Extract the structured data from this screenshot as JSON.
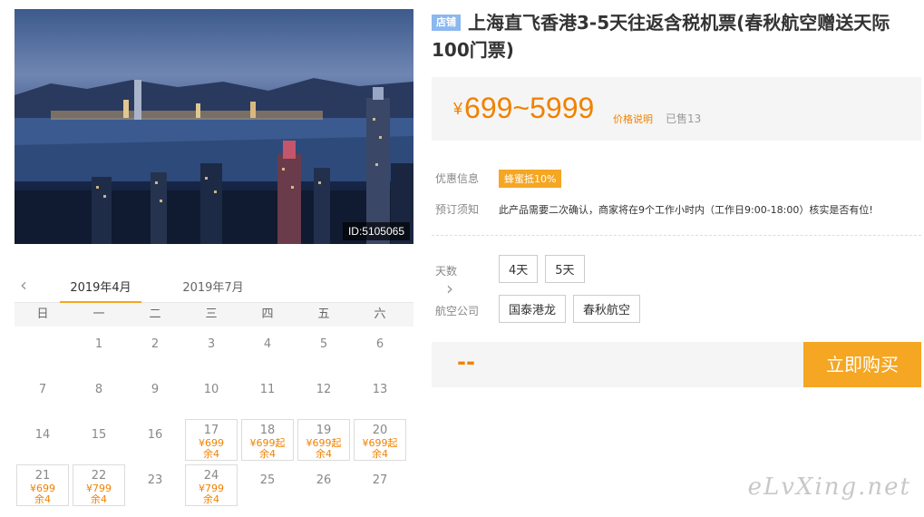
{
  "hero": {
    "id_label": "ID:5105065"
  },
  "calendar": {
    "prev_icon": "chevron-left-icon",
    "next_icon": "chevron-right-icon",
    "months": [
      "2019年4月",
      "2019年7月"
    ],
    "weekdays": [
      "日",
      "一",
      "二",
      "三",
      "四",
      "五",
      "六"
    ],
    "days": [
      {
        "d": ""
      },
      {
        "d": "1"
      },
      {
        "d": "2"
      },
      {
        "d": "3"
      },
      {
        "d": "4"
      },
      {
        "d": "5"
      },
      {
        "d": "6"
      },
      {
        "d": "7"
      },
      {
        "d": "8"
      },
      {
        "d": "9"
      },
      {
        "d": "10"
      },
      {
        "d": "11"
      },
      {
        "d": "12"
      },
      {
        "d": "13"
      },
      {
        "d": "14"
      },
      {
        "d": "15"
      },
      {
        "d": "16"
      },
      {
        "d": "17",
        "price": "¥699",
        "stock": "余4"
      },
      {
        "d": "18",
        "price": "¥699起",
        "stock": "余4"
      },
      {
        "d": "19",
        "price": "¥699起",
        "stock": "余4"
      },
      {
        "d": "20",
        "price": "¥699起",
        "stock": "余4"
      },
      {
        "d": "21",
        "price": "¥699",
        "stock": "余4"
      },
      {
        "d": "22",
        "price": "¥799",
        "stock": "余4"
      },
      {
        "d": "23"
      },
      {
        "d": "24",
        "price": "¥799",
        "stock": "余4"
      },
      {
        "d": "25"
      },
      {
        "d": "26"
      },
      {
        "d": "27"
      }
    ]
  },
  "product": {
    "shop_tag": "店铺",
    "title": "上海直飞香港3-5天往返含税机票(春秋航空赠送天际100门票)",
    "price_symbol": "¥",
    "price_range": "699~5999",
    "price_explain": "价格说明",
    "sold": "已售13"
  },
  "info": {
    "promo_label": "优惠信息",
    "promo_badge": "蜂蜜抵10%",
    "notice_label": "预订须知",
    "notice_text": "此产品需要二次确认，商家将在9个工作小时内（工作日9:00-18:00）核实是否有位!",
    "days_label": "天数",
    "days_options": [
      "4天",
      "5天"
    ],
    "airline_label": "航空公司",
    "airline_options": [
      "国泰港龙",
      "春秋航空"
    ]
  },
  "purchase": {
    "total": "--",
    "buy_label": "立即购买"
  },
  "watermark": "eLvXing.net",
  "colors": {
    "accent": "#f5a623",
    "price": "#f08200",
    "shop_tag": "#8bb8ee"
  }
}
